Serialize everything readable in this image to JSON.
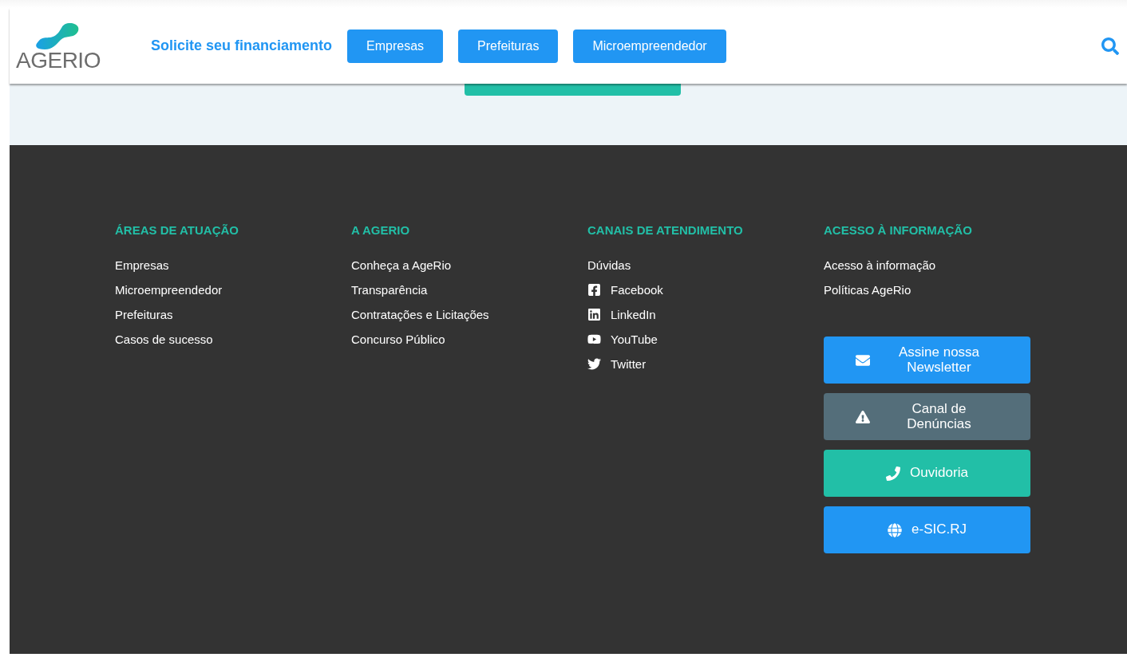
{
  "header": {
    "logo": "AGERIO",
    "prompt": "Solicite seu financiamento",
    "buttons": [
      "Empresas",
      "Prefeituras",
      "Microempreendedor"
    ]
  },
  "footer": {
    "columns": [
      {
        "title": "ÁREAS DE ATUAÇÃO",
        "links": [
          {
            "label": "Empresas",
            "kind": "text"
          },
          {
            "label": "Microempreendedor",
            "kind": "text"
          },
          {
            "label": "Prefeituras",
            "kind": "text"
          },
          {
            "label": "Casos de sucesso",
            "kind": "text"
          }
        ]
      },
      {
        "title": "A AGERIO",
        "links": [
          {
            "label": "Conheça a AgeRio",
            "kind": "text"
          },
          {
            "label": "Transparência",
            "kind": "text"
          },
          {
            "label": "Contratações e Licitações",
            "kind": "text"
          },
          {
            "label": "Concurso Público",
            "kind": "text"
          }
        ]
      },
      {
        "title": "CANAIS DE ATENDIMENTO",
        "links": [
          {
            "label": "Dúvidas",
            "kind": "text"
          },
          {
            "label": "Facebook",
            "kind": "facebook"
          },
          {
            "label": "LinkedIn",
            "kind": "linkedin"
          },
          {
            "label": "YouTube",
            "kind": "youtube"
          },
          {
            "label": "Twitter",
            "kind": "twitter"
          }
        ]
      },
      {
        "title": "ACESSO À INFORMAÇÃO",
        "links": [
          {
            "label": "Acesso à informação",
            "kind": "text"
          },
          {
            "label": "Políticas AgeRio",
            "kind": "text"
          }
        ]
      }
    ],
    "actions": [
      {
        "label": "Assine nossa Newsletter",
        "kind": "newsletter",
        "color": "#2196f3"
      },
      {
        "label": "Canal de Denúncias",
        "kind": "warning",
        "color": "#546e7a"
      },
      {
        "label": "Ouvidoria",
        "kind": "phone",
        "color": "#22bfa7"
      },
      {
        "label": "e-SIC.RJ",
        "kind": "globe",
        "color": "#2196f3"
      }
    ]
  }
}
